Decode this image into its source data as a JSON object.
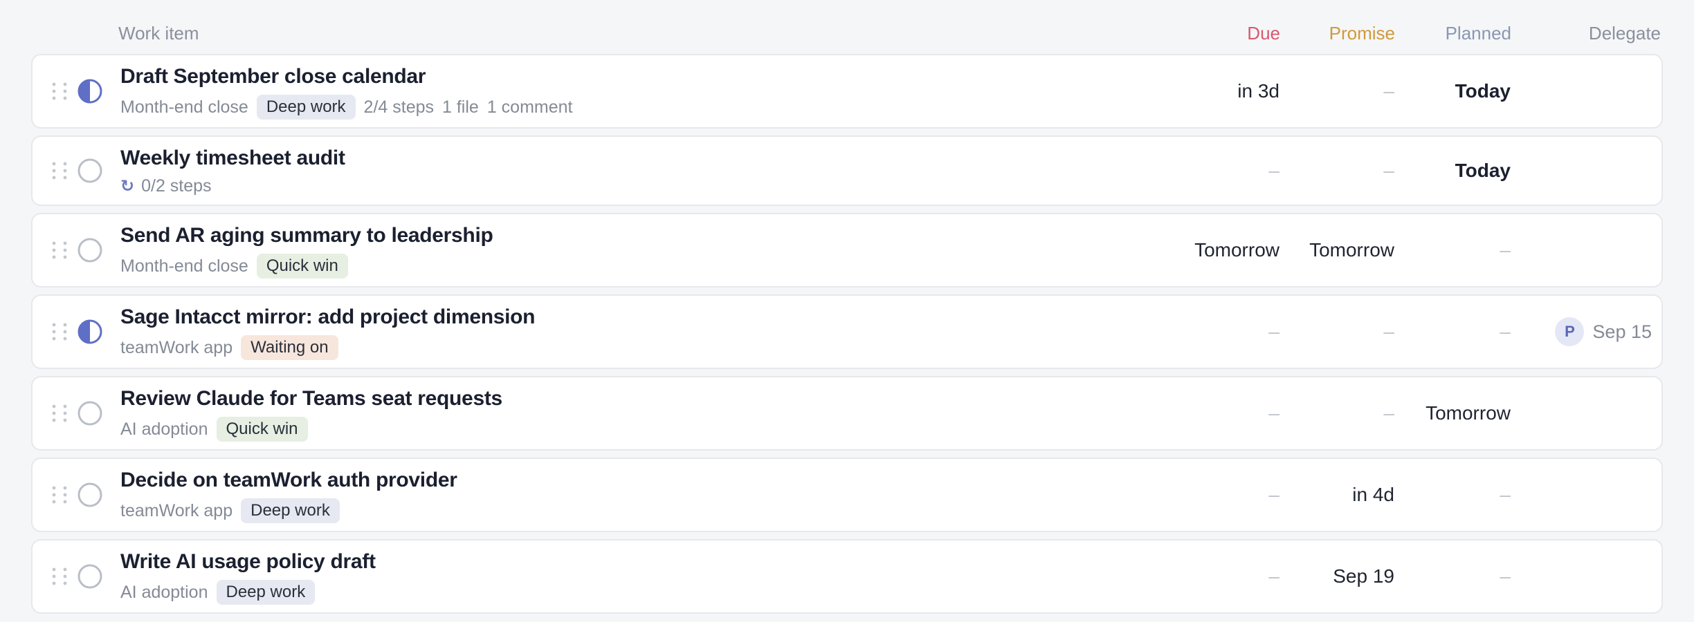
{
  "columns": {
    "work_item": "Work item",
    "due": "Due",
    "promise": "Promise",
    "planned": "Planned",
    "delegate": "Delegate"
  },
  "colors": {
    "due_header": "#d9596f",
    "promise_header": "#cf9a3a",
    "planned_header": "#8a97b0",
    "status_accent": "#5f6fc6"
  },
  "rows": [
    {
      "title": "Draft September close calendar",
      "status": "in-progress",
      "project": "Month-end close",
      "tag": "Deep work",
      "steps": "2/4 steps",
      "files": "1 file",
      "comments": "1 comment",
      "due": "in 3d",
      "promise": "–",
      "planned": "Today",
      "delegate_avatar": "",
      "delegate_date": ""
    },
    {
      "title": "Weekly timesheet audit",
      "status": "not-started",
      "repeat_icon": "↻",
      "steps": "0/2 steps",
      "due": "–",
      "promise": "–",
      "planned": "Today",
      "delegate_avatar": "",
      "delegate_date": ""
    },
    {
      "title": "Send AR aging summary to leadership",
      "status": "not-started",
      "project": "Month-end close",
      "tag": "Quick win",
      "due": "Tomorrow",
      "promise": "Tomorrow",
      "planned": "–",
      "delegate_avatar": "",
      "delegate_date": ""
    },
    {
      "title": "Sage Intacct mirror: add project dimension",
      "status": "in-progress",
      "project": "teamWork app",
      "tag": "Waiting on",
      "due": "–",
      "promise": "–",
      "planned": "–",
      "delegate_avatar": "P",
      "delegate_date": "Sep 15"
    },
    {
      "title": "Review Claude for Teams seat requests",
      "status": "not-started",
      "project": "AI adoption",
      "tag": "Quick win",
      "due": "–",
      "promise": "–",
      "planned": "Tomorrow",
      "delegate_avatar": "",
      "delegate_date": ""
    },
    {
      "title": "Decide on teamWork auth provider",
      "status": "not-started",
      "project": "teamWork app",
      "tag": "Deep work",
      "due": "–",
      "promise": "in 4d",
      "planned": "–",
      "delegate_avatar": "",
      "delegate_date": ""
    },
    {
      "title": "Write AI usage policy draft",
      "status": "not-started",
      "project": "AI adoption",
      "tag": "Deep work",
      "due": "–",
      "promise": "Sep 19",
      "planned": "–",
      "delegate_avatar": "",
      "delegate_date": ""
    }
  ]
}
